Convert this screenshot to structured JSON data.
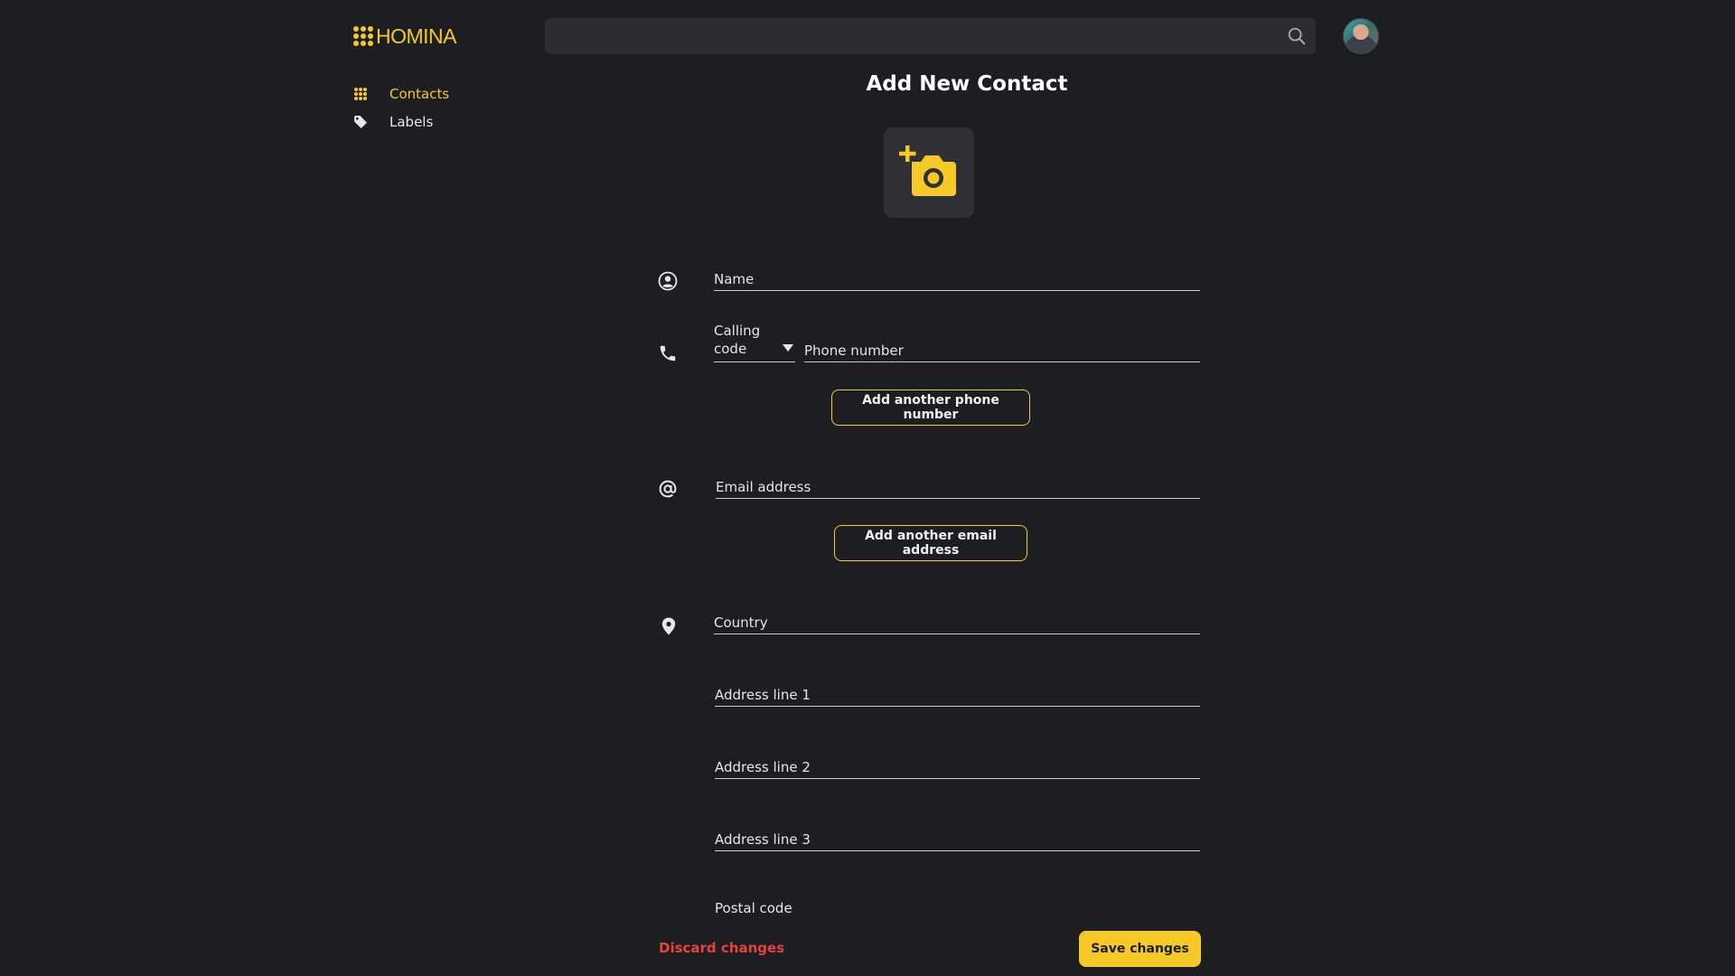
{
  "app": {
    "brand": "HOMINA",
    "brand_color": "#f6c928",
    "background_color": "#1c1e22"
  },
  "header": {
    "search": {
      "placeholder": "",
      "value": ""
    },
    "search_icon": "search-icon",
    "avatar_icon": "user-avatar"
  },
  "sidebar": {
    "items": [
      {
        "label": "Contacts",
        "icon": "grid-icon",
        "active": true
      },
      {
        "label": "Labels",
        "icon": "tag-icon",
        "active": false
      }
    ]
  },
  "form": {
    "title": "Add New Contact",
    "photo_icon": "add-photo-icon",
    "name": {
      "placeholder": "Name",
      "value": ""
    },
    "calling_code": {
      "label": "Calling code",
      "value": ""
    },
    "phone": {
      "placeholder": "Phone number",
      "value": ""
    },
    "add_phone_label": "Add another phone number",
    "email": {
      "placeholder": "Email address",
      "value": ""
    },
    "add_email_label": "Add another email address",
    "country": {
      "placeholder": "Country",
      "value": ""
    },
    "address_line_1": {
      "placeholder": "Address line 1",
      "value": ""
    },
    "address_line_2": {
      "placeholder": "Address line 2",
      "value": ""
    },
    "address_line_3": {
      "placeholder": "Address line 3",
      "value": ""
    },
    "postal_code": {
      "label": "Postal code",
      "value": ""
    }
  },
  "actions": {
    "discard_label": "Discard changes",
    "discard_color": "#e8423c",
    "save_label": "Save changes"
  }
}
